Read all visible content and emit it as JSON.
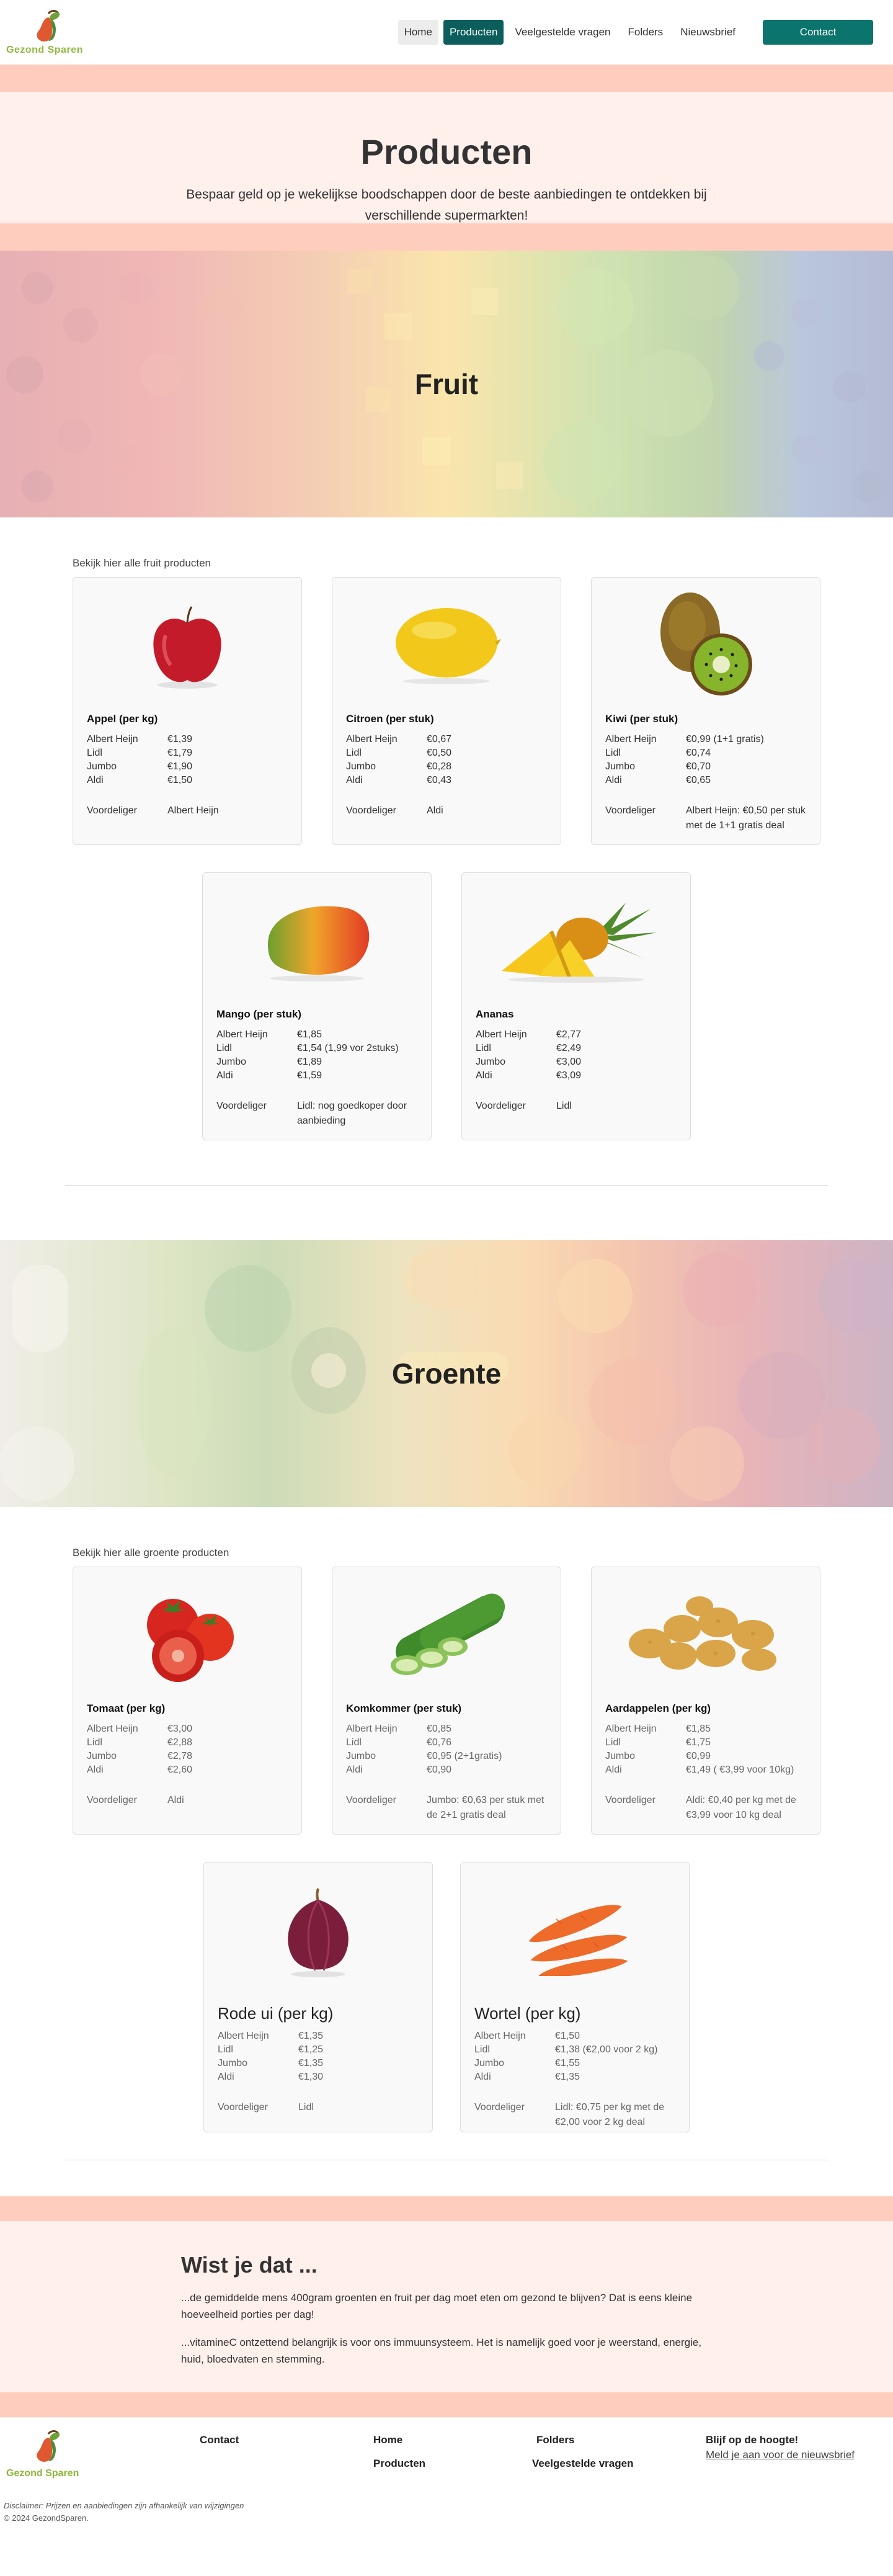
{
  "brand": {
    "name": "Gezond Sparen"
  },
  "nav": {
    "items": [
      {
        "label": "Home"
      },
      {
        "label": "Producten"
      },
      {
        "label": "Veelgestelde vragen"
      },
      {
        "label": "Folders"
      },
      {
        "label": "Nieuwsbrief"
      }
    ],
    "contact_label": "Contact"
  },
  "hero": {
    "title": "Producten",
    "subtitle": "Bespaar geld op je wekelijkse boodschappen door de beste aanbiedingen te ontdekken bij verschillende supermarkten!"
  },
  "fruit": {
    "banner_title": "Fruit",
    "section_label": "Bekijk hier alle fruit producten",
    "cards": [
      {
        "title": "Appel (per kg)",
        "prices": [
          [
            "Albert Heijn",
            "€1,39"
          ],
          [
            "Lidl",
            "€1,79"
          ],
          [
            "Jumbo",
            "€1,90"
          ],
          [
            "Aldi",
            "€1,50"
          ]
        ],
        "cheaper_label": "Voordeliger",
        "cheaper": "Albert Heijn"
      },
      {
        "title": "Citroen (per stuk)",
        "prices": [
          [
            "Albert Heijn",
            "€0,67"
          ],
          [
            "Lidl",
            "€0,50"
          ],
          [
            "Jumbo",
            "€0,28"
          ],
          [
            "Aldi",
            "€0,43"
          ]
        ],
        "cheaper_label": "Voordeliger",
        "cheaper": "Aldi"
      },
      {
        "title": "Kiwi (per stuk)",
        "prices": [
          [
            "Albert Heijn",
            "€0,99  (1+1 gratis)"
          ],
          [
            "Lidl",
            "€0,74"
          ],
          [
            "Jumbo",
            "€0,70"
          ],
          [
            "Aldi",
            "€0,65"
          ]
        ],
        "cheaper_label": "Voordeliger",
        "cheaper": "Albert Heijn: €0,50 per stuk met de 1+1 gratis deal"
      },
      {
        "title": "Mango (per stuk)",
        "prices": [
          [
            "Albert Heijn",
            "€1,85"
          ],
          [
            "Lidl",
            "€1,54 (1,99 vor 2stuks)"
          ],
          [
            "Jumbo",
            "€1,89"
          ],
          [
            "Aldi",
            "€1,59"
          ]
        ],
        "cheaper_label": "Voordeliger",
        "cheaper": "Lidl: nog goedkoper door aanbieding"
      },
      {
        "title": "Ananas",
        "prices": [
          [
            "Albert Heijn",
            "€2,77"
          ],
          [
            "Lidl",
            "€2,49"
          ],
          [
            "Jumbo",
            "€3,00"
          ],
          [
            "Aldi",
            "€3,09"
          ]
        ],
        "cheaper_label": "Voordeliger",
        "cheaper": "Lidl"
      }
    ]
  },
  "groente": {
    "banner_title": "Groente",
    "section_label": "Bekijk hier alle groente producten",
    "cards": [
      {
        "title": "Tomaat (per kg)",
        "prices": [
          [
            "Albert Heijn",
            "€3,00"
          ],
          [
            "Lidl",
            "€2,88"
          ],
          [
            "Jumbo",
            "€2,78"
          ],
          [
            "Aldi",
            "€2,60"
          ]
        ],
        "cheaper_label": "Voordeliger",
        "cheaper": "Aldi"
      },
      {
        "title": "Komkommer (per stuk)",
        "prices": [
          [
            "Albert Heijn",
            "€0,85"
          ],
          [
            "Lidl",
            "€0,76"
          ],
          [
            "Jumbo",
            "€0,95 (2+1gratis)"
          ],
          [
            "Aldi",
            "€0,90"
          ]
        ],
        "cheaper_label": "Voordeliger",
        "cheaper": "Jumbo:  €0,63 per stuk met de 2+1 gratis deal"
      },
      {
        "title": "Aardappelen (per kg)",
        "prices": [
          [
            "Albert Heijn",
            "€1,85"
          ],
          [
            "Lidl",
            "€1,75"
          ],
          [
            "Jumbo",
            "€0,99"
          ],
          [
            "Aldi",
            "€1,49 ( €3,99 voor 10kg)"
          ]
        ],
        "cheaper_label": "Voordeliger",
        "cheaper": "Aldi: €0,40 per kg met de €3,99 voor 10 kg deal"
      },
      {
        "title": "Rode ui (per kg)",
        "prices": [
          [
            "Albert Heijn",
            "€1,35"
          ],
          [
            "Lidl",
            "€1,25"
          ],
          [
            "Jumbo",
            "€1,35"
          ],
          [
            "Aldi",
            "€1,30"
          ]
        ],
        "cheaper_label": "Voordeliger",
        "cheaper": "Lidl"
      },
      {
        "title": "Wortel (per kg)",
        "prices": [
          [
            "Albert Heijn",
            "€1,50"
          ],
          [
            "Lidl",
            "€1,38 (€2,00 voor 2 kg)"
          ],
          [
            "Jumbo",
            "€1,55"
          ],
          [
            "Aldi",
            "€1,35"
          ]
        ],
        "cheaper_label": "Voordeliger",
        "cheaper": "Lidl: €0,75 per kg met de €2,00 voor 2 kg deal"
      }
    ]
  },
  "facts": {
    "title": "Wist je dat ...",
    "p1": "...de gemiddelde mens 400gram groenten en fruit per dag moet eten om gezond te blijven? Dat is eens kleine hoeveelheid porties per dag!",
    "p2": "...vitamineC ontzettend belangrijk is voor ons immuunsysteem. Het is namelijk goed voor je weerstand, energie, huid, bloedvaten en stemming."
  },
  "footer": {
    "contact": "Contact",
    "home": "Home",
    "producten": "Producten",
    "folders": "Folders",
    "faq": "Veelgestelde vragen",
    "newsletter_title": "Blijf op de hoogte!",
    "newsletter_link": "Meld je aan voor de nieuwsbrief",
    "disclaimer": "Disclaimer: Prijzen en aanbiedingen zijn afhankelijk van wijzigingen",
    "copyright": "© 2024 GezondSparen."
  },
  "colors": {
    "accent": "#0b746c",
    "peach": "#ffcdbd",
    "light_peach": "#fff0ec",
    "brand_green": "#8fb83c"
  }
}
